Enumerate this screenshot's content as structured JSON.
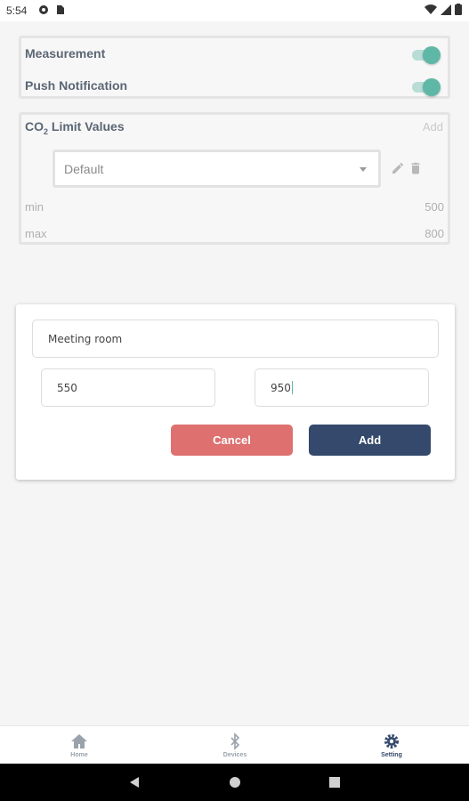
{
  "status_bar": {
    "time": "5:54"
  },
  "settings": {
    "measurement_label": "Measurement",
    "push_label": "Push Notification"
  },
  "co2": {
    "title_prefix": "CO",
    "title_sub": "2",
    "title_suffix": " Limit Values",
    "add_label": "Add",
    "selected_profile": "Default",
    "min_label": "min",
    "min_value": "500",
    "max_label": "max",
    "max_value": "800"
  },
  "dialog": {
    "name_value": "Meeting room",
    "min_value": "550",
    "max_value": "950",
    "cancel_label": "Cancel",
    "add_label": "Add"
  },
  "bottom_nav": {
    "home_label": "Home",
    "devices_label": "Devices",
    "setting_label": "Setting"
  },
  "colors": {
    "accent": "#5fb8a7",
    "cancel": "#de7070",
    "primary": "#34496b"
  }
}
